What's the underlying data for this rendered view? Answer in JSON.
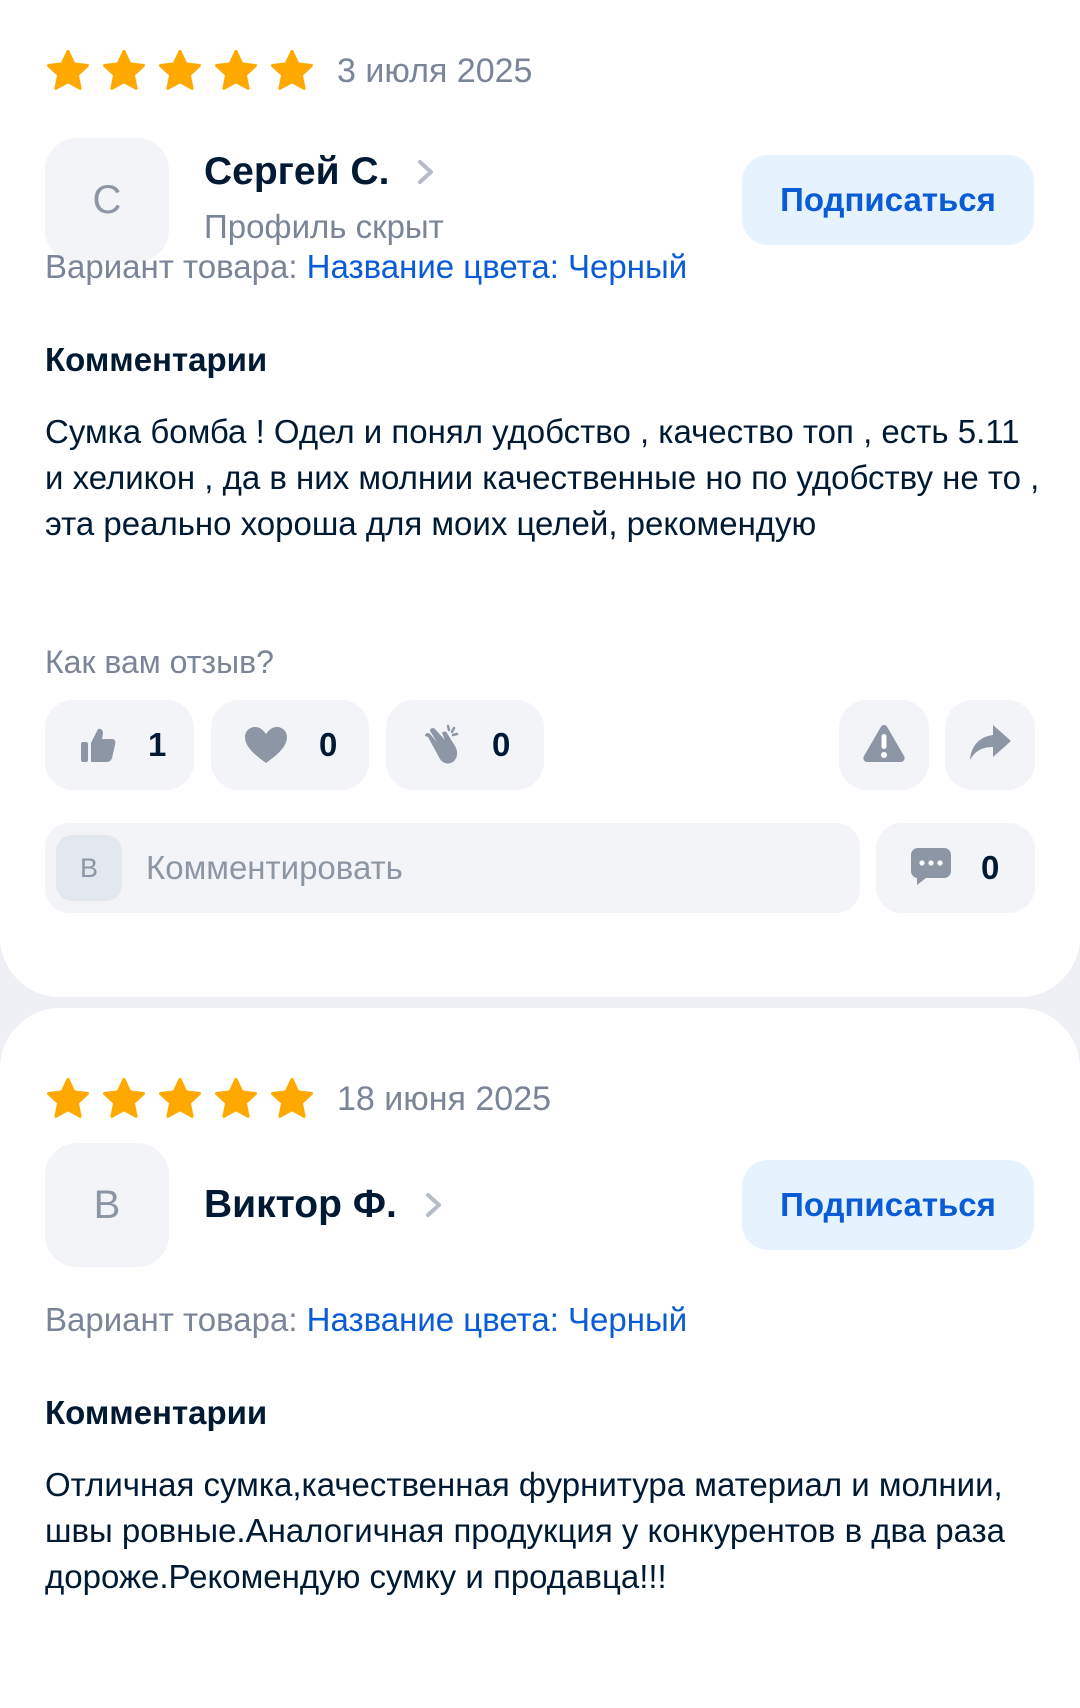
{
  "reviews": [
    {
      "rating": 5,
      "date": "3 июля 2025",
      "author": {
        "initial": "С",
        "name": "Сергей С.",
        "subtitle": "Профиль скрыт"
      },
      "subscribe_label": "Подписаться",
      "variant_label": "Вариант товара:",
      "variant_value": "Название цвета: Черный",
      "comments_title": "Комментарии",
      "text": "Сумка бомба ! Одел и понял удобство , качество топ , есть 5.11 и хеликон , да в них молнии качественные но по удобству не то , эта реально хороша для моих целей, рекомендую",
      "feedback_question": "Как вам отзыв?",
      "reactions": {
        "likes": "1",
        "hearts": "0",
        "claps": "0"
      },
      "comment_avatar_initial": "В",
      "comment_placeholder": "Комментировать",
      "comments_count": "0"
    },
    {
      "rating": 5,
      "date": "18 июня 2025",
      "author": {
        "initial": "В",
        "name": "Виктор Ф."
      },
      "subscribe_label": "Подписаться",
      "variant_label": "Вариант товара:",
      "variant_value": "Название цвета: Черный",
      "comments_title": "Комментарии",
      "text": "Отличная сумка,качественная фурнитура материал и молнии, швы ровные.Аналогичная продукция у конкурентов в два раза дороже.Рекомендую сумку и продавца!!!"
    }
  ],
  "icons": {
    "star": "star-icon",
    "chevron": "chevron-right-icon",
    "like": "thumbs-up-icon",
    "heart": "heart-icon",
    "clap": "clap-icon",
    "report": "warning-icon",
    "share": "share-icon",
    "comment": "comment-bubble-icon"
  },
  "colors": {
    "star": "#ffa800",
    "accent_blue": "#0a5bd6",
    "subscribe_bg": "#e6f3ff",
    "muted_text": "#7a8598",
    "icon_gray": "#8d96a5"
  }
}
